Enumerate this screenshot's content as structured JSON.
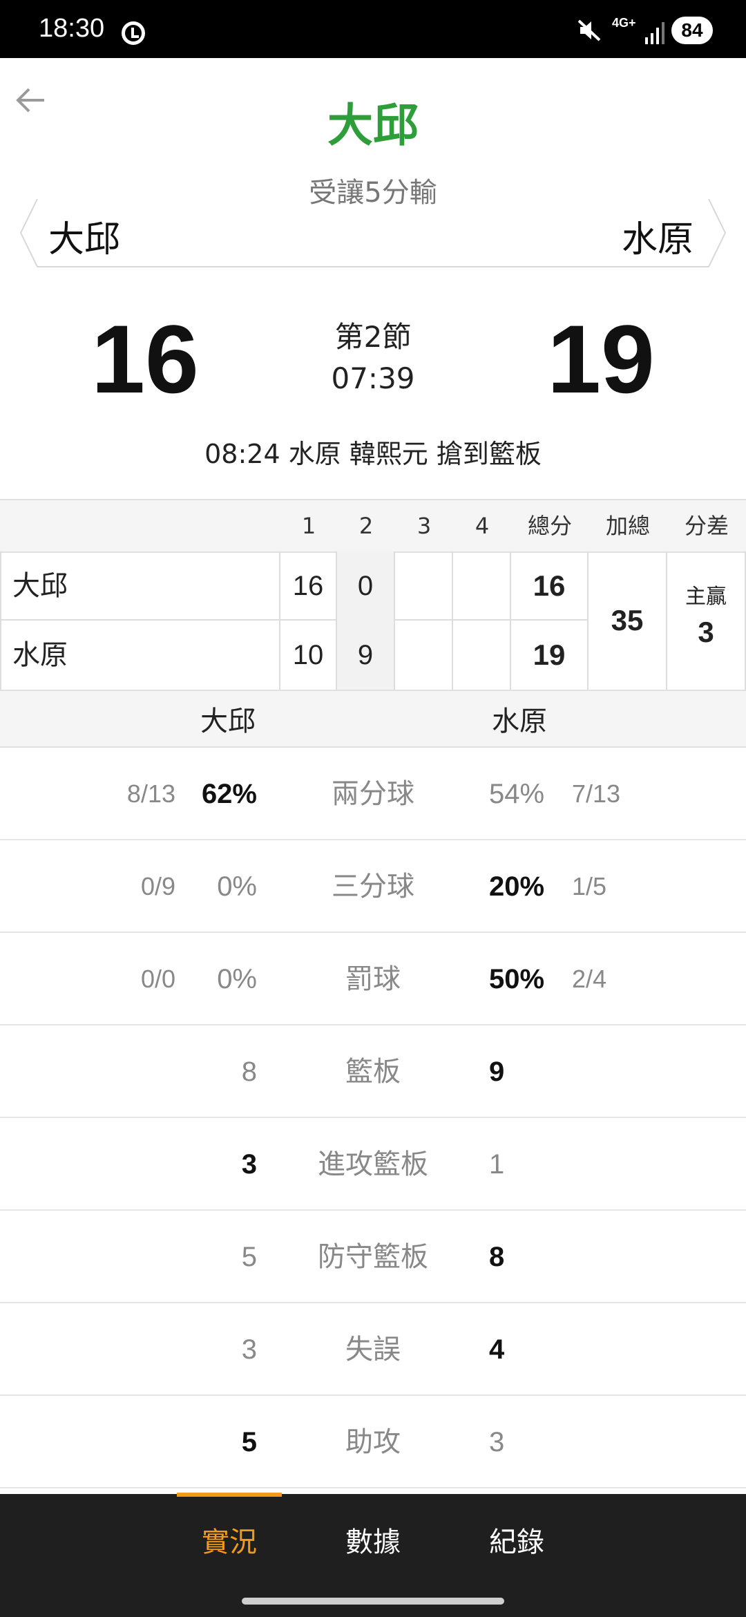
{
  "status_bar": {
    "time": "18:30",
    "network": "4G+",
    "battery": "84"
  },
  "header": {
    "title": "大邱",
    "subtitle": "受讓5分輸",
    "home_team": "大邱",
    "away_team": "水原"
  },
  "scoreboard": {
    "home_score": "16",
    "away_score": "19",
    "period": "第2節",
    "clock": "07:39",
    "last_event": "08:24 水原 韓熙元 搶到籃板"
  },
  "quarter_table": {
    "headers": [
      "1",
      "2",
      "3",
      "4",
      "總分",
      "加總",
      "分差"
    ],
    "rows": [
      {
        "team": "大邱",
        "q1": "16",
        "q2": "0",
        "q3": "",
        "q4": "",
        "total": "16"
      },
      {
        "team": "水原",
        "q1": "10",
        "q2": "9",
        "q3": "",
        "q4": "",
        "total": "19"
      }
    ],
    "combined": "35",
    "diff_label": "主贏",
    "diff_value": "3"
  },
  "stats": {
    "home_team": "大邱",
    "away_team": "水原",
    "rows": [
      {
        "label": "兩分球",
        "home_frac": "8/13",
        "home_val": "62%",
        "away_val": "54%",
        "away_frac": "7/13"
      },
      {
        "label": "三分球",
        "home_frac": "0/9",
        "home_val": "0%",
        "away_val": "20%",
        "away_frac": "1/5"
      },
      {
        "label": "罰球",
        "home_frac": "0/0",
        "home_val": "0%",
        "away_val": "50%",
        "away_frac": "2/4"
      },
      {
        "label": "籃板",
        "home_frac": "",
        "home_val": "8",
        "away_val": "9",
        "away_frac": ""
      },
      {
        "label": "進攻籃板",
        "home_frac": "",
        "home_val": "3",
        "away_val": "1",
        "away_frac": ""
      },
      {
        "label": "防守籃板",
        "home_frac": "",
        "home_val": "5",
        "away_val": "8",
        "away_frac": ""
      },
      {
        "label": "失誤",
        "home_frac": "",
        "home_val": "3",
        "away_val": "4",
        "away_frac": ""
      },
      {
        "label": "助攻",
        "home_frac": "",
        "home_val": "5",
        "away_val": "3",
        "away_frac": ""
      }
    ]
  },
  "bottom_nav": {
    "items": [
      "實況",
      "數據",
      "紀錄"
    ],
    "active": "實況"
  },
  "colors": {
    "accent": "#f39a1d",
    "title_green": "#2e9e3a",
    "nav_bg": "#1f1f1f"
  },
  "icons": [
    "back-arrow-icon",
    "mute-icon",
    "signal-icon",
    "clock-app-icon"
  ]
}
